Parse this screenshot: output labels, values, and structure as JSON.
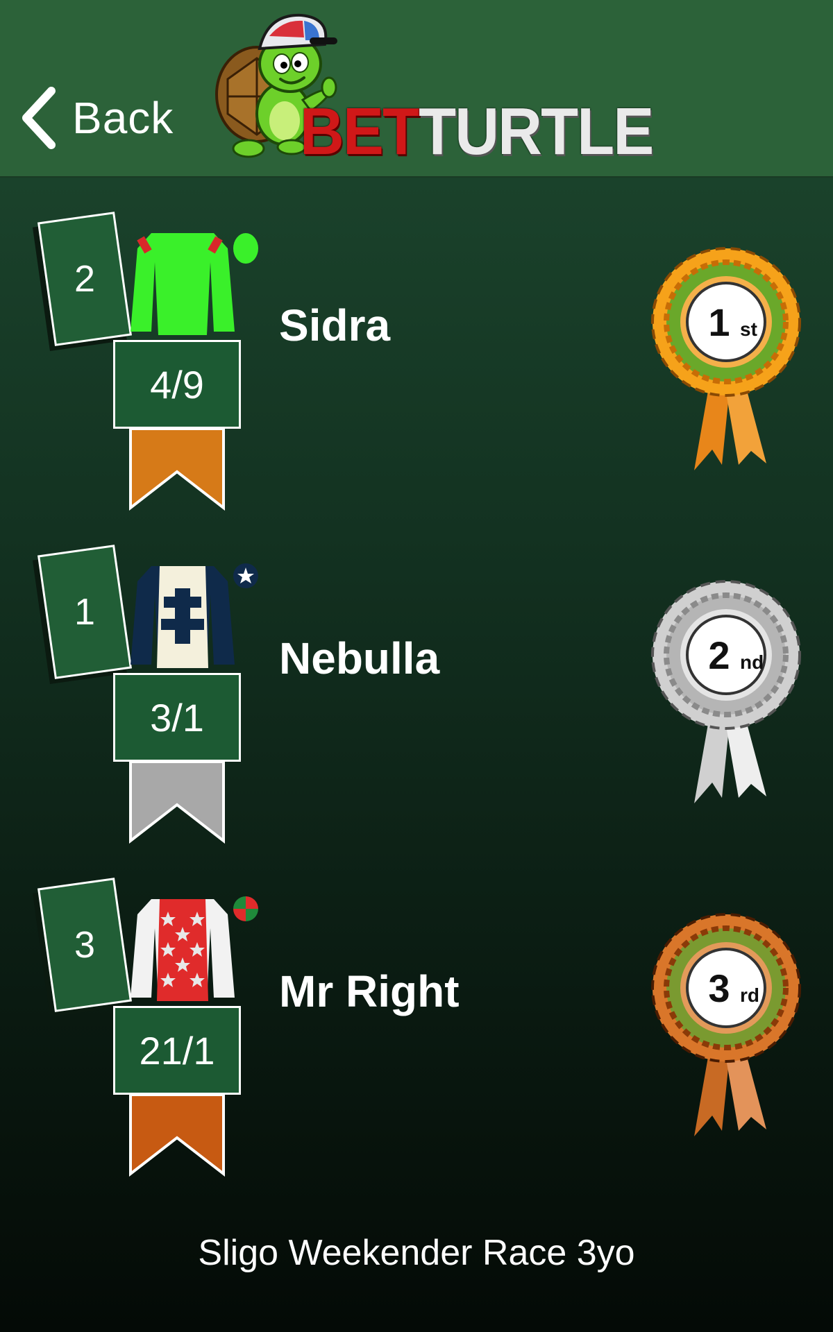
{
  "header": {
    "back_label": "Back",
    "logo_text_bet": "BET",
    "logo_text_turtle": "TURTLE"
  },
  "runners": [
    {
      "saddlecloth": "2",
      "name": "Sidra",
      "odds": "4/9",
      "position": "1",
      "position_suffix": "st",
      "silks": "bright green jacket, red shoulder marks, green cap",
      "ribbon_color": "#d67a18",
      "rosette_colors": [
        "#f6a21a",
        "#c76d06",
        "#6aa82a"
      ]
    },
    {
      "saddlecloth": "1",
      "name": "Nebulla",
      "odds": "3/1",
      "position": "2",
      "position_suffix": "nd",
      "silks": "cream jacket, navy cross of lorraine, navy sleeves, navy cap with white star",
      "ribbon_color": "#a8a8a8",
      "rosette_colors": [
        "#d0d0d0",
        "#8a8a8a",
        "#b5b5b5"
      ]
    },
    {
      "saddlecloth": "3",
      "name": "Mr Right",
      "odds": "21/1",
      "position": "3",
      "position_suffix": "rd",
      "silks": "red jacket with white stars, white sleeves, red and green quartered cap",
      "ribbon_color": "#c75a12",
      "rosette_colors": [
        "#d9762a",
        "#8a3a08",
        "#7a9a30"
      ]
    }
  ],
  "race": {
    "name": "Sligo Weekender Race 3yo"
  }
}
